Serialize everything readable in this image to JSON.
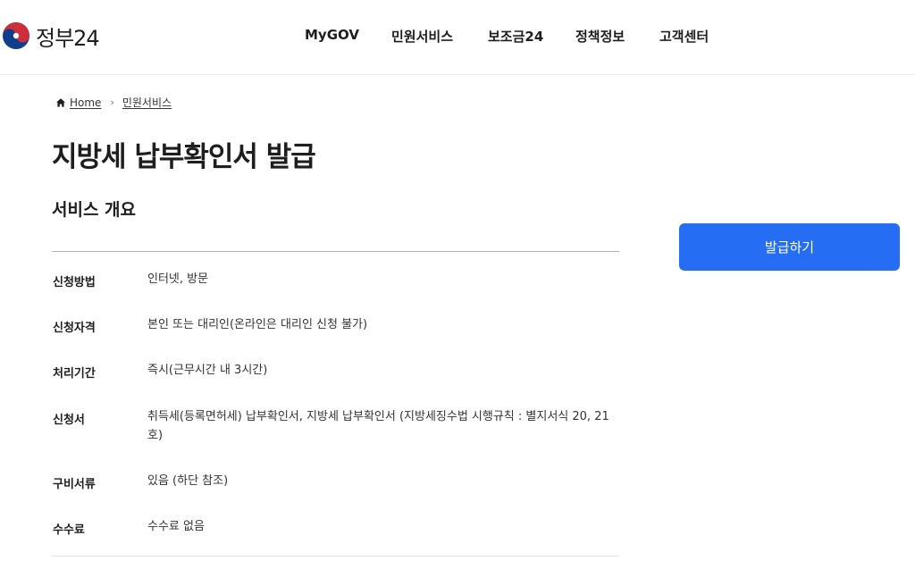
{
  "header": {
    "logo_text": "정부24",
    "nav": [
      {
        "label": "MyGOV"
      },
      {
        "label": "민원서비스"
      },
      {
        "label": "보조금24"
      },
      {
        "label": "정책정보"
      },
      {
        "label": "고객센터"
      }
    ]
  },
  "breadcrumb": {
    "home": "Home",
    "current": "민원서비스"
  },
  "page": {
    "title": "지방세 납부확인서 발급",
    "section_title": "서비스 개요",
    "issue_button": "발급하기"
  },
  "overview": [
    {
      "label": "신청방법",
      "value": "인터넷, 방문"
    },
    {
      "label": "신청자격",
      "value": "본인 또는 대리인(온라인은 대리인 신청 불가)"
    },
    {
      "label": "처리기간",
      "value": "즉시(근무시간 내 3시간)"
    },
    {
      "label": "신청서",
      "value": "취득세(등록면허세) 납부확인서, 지방세 납부확인서 (지방세징수법 시행규칙 : 별지서식 20, 21호)"
    },
    {
      "label": "구비서류",
      "value": "있음 (하단 참조)"
    },
    {
      "label": "수수료",
      "value": "수수료 없음"
    }
  ],
  "colors": {
    "primary": "#256ef4",
    "text": "#1e1e1e",
    "logo_red": "#cd2e3a",
    "logo_blue": "#0f3f8c"
  },
  "icons": [
    "government-emblem-icon",
    "home-icon",
    "chevron-right-icon"
  ]
}
